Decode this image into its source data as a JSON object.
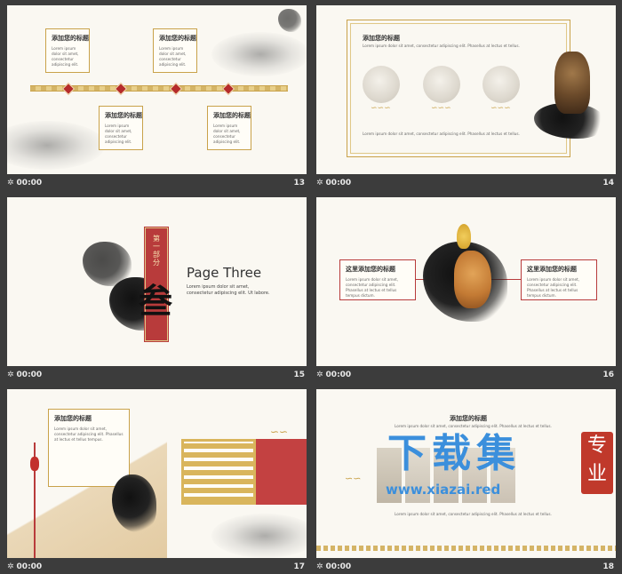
{
  "slides": [
    {
      "number": "13",
      "time": "00:00",
      "boxes": [
        {
          "title": "添加您的标题",
          "body": "Lorem ipsum dolor sit amet, consectetur adipiscing elit."
        },
        {
          "title": "添加您的标题",
          "body": "Lorem ipsum dolor sit amet, consectetur adipiscing elit."
        },
        {
          "title": "添加您的标题",
          "body": "Lorem ipsum dolor sit amet, consectetur adipiscing elit."
        },
        {
          "title": "添加您的标题",
          "body": "Lorem ipsum dolor sit amet, consectetur adipiscing elit."
        }
      ]
    },
    {
      "number": "14",
      "time": "00:00",
      "title": "添加您的标题",
      "body": "Lorem ipsum dolor sit amet, consectetur adipiscing elit. Phasellus at lectus et tellus.",
      "body2": "Lorem ipsum dolor sit amet, consectetur adipiscing elit. Phasellus at lectus et tellus."
    },
    {
      "number": "15",
      "time": "00:00",
      "vertical_label": "第一部分",
      "big_char": "叁",
      "heading": "Page Three",
      "body": "Lorem ipsum dolor sit amet, consectetur adipiscing elit. Ut labore."
    },
    {
      "number": "16",
      "time": "00:00",
      "boxes": [
        {
          "title": "这里添加您的标题",
          "body": "Lorem ipsum dolor sit amet, consectetur adipiscing elit. Phasellus at lectus et tellus tempus dictum."
        },
        {
          "title": "这里添加您的标题",
          "body": "Lorem ipsum dolor sit amet, consectetur adipiscing elit. Phasellus at lectus et tellus tempus dictum."
        }
      ]
    },
    {
      "number": "17",
      "time": "00:00",
      "title": "添加您的标题",
      "body": "Lorem ipsum dolor sit amet, consectetur adipiscing elit. Phasellus at lectus et tellus tempus."
    },
    {
      "number": "18",
      "time": "00:00",
      "title": "添加您的标题",
      "body": "Lorem ipsum dolor sit amet, consectetur adipiscing elit. Phasellus at lectus et tellus.",
      "body2": "Lorem ipsum dolor sit amet, consectetur adipiscing elit. Phasellus at lectus et tellus."
    }
  ],
  "watermark": {
    "title": "下载集",
    "url": "www.xiazai.red",
    "stamp": "专业"
  },
  "colors": {
    "gold": "#c9a24a",
    "red": "#b83b3b",
    "background": "#3c3c3c"
  }
}
